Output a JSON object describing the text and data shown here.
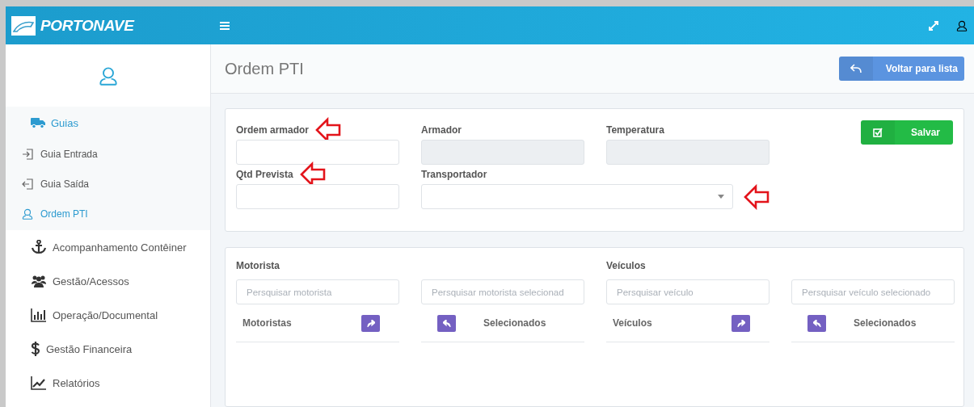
{
  "header": {
    "brand": "PORTONAVE"
  },
  "sidebar": {
    "items": [
      {
        "label": "Guias",
        "selected": true,
        "expanded": true,
        "children": [
          {
            "label": "Guia Entrada",
            "selected": false
          },
          {
            "label": "Guia Saída",
            "selected": false
          },
          {
            "label": "Ordem PTI",
            "selected": true
          }
        ]
      },
      {
        "label": "Acompanhamento Contêiner",
        "selected": false,
        "expanded": false
      },
      {
        "label": "Gestão/Acessos",
        "selected": false,
        "expanded": false
      },
      {
        "label": "Operação/Documental",
        "selected": false,
        "expanded": false
      },
      {
        "label": "Gestão Financeira",
        "selected": false,
        "expanded": false
      },
      {
        "label": "Relatórios",
        "selected": false,
        "expanded": false
      }
    ]
  },
  "page": {
    "title": "Ordem PTI",
    "back_button": "Voltar para lista"
  },
  "form": {
    "save_button": "Salvar",
    "fields": [
      {
        "label": "Ordem armador",
        "kind": "text",
        "annotated": true
      },
      {
        "label": "Armador",
        "kind": "readonly",
        "annotated": false
      },
      {
        "label": "Temperatura",
        "kind": "readonly",
        "annotated": false
      },
      {
        "label": "Qtd Prevista",
        "kind": "text",
        "annotated": true
      },
      {
        "label": "Transportador",
        "kind": "select",
        "annotated": true
      }
    ]
  },
  "picklists": [
    {
      "label": "Motorista",
      "search_placeholder": "Persquisar motorista",
      "selected_search_placeholder": "Persquisar motorista selecionad",
      "available_label": "Motoristas",
      "selected_label": "Selecionados"
    },
    {
      "label": "Veículos",
      "search_placeholder": "Persquisar veículo",
      "selected_search_placeholder": "Persquisar veículo selecionado",
      "available_label": "Veículos",
      "selected_label": "Selecionados"
    }
  ]
}
